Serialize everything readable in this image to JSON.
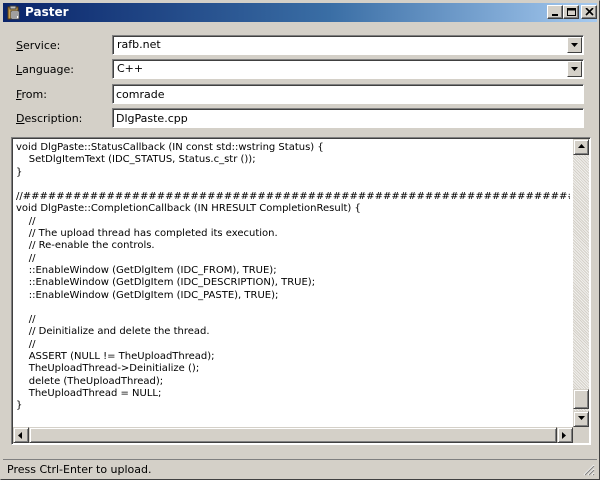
{
  "window": {
    "title": "Paster",
    "app_icon": "paste-app-icon",
    "controls": [
      "minimize-icon",
      "maximize-icon",
      "close-icon"
    ]
  },
  "form": {
    "service": {
      "label": "Service:",
      "accel": "S",
      "rest": "ervice:",
      "value": "rafb.net"
    },
    "language": {
      "label": "Language:",
      "accel": "L",
      "rest": "anguage:",
      "value": "C++"
    },
    "from": {
      "label": "From:",
      "accel": "F",
      "rest": "rom:",
      "value": "comrade"
    },
    "description": {
      "label": "Description:",
      "accel": "D",
      "rest": "escription:",
      "value": "DlgPaste.cpp"
    }
  },
  "editor": {
    "lines": [
      "void DlgPaste::StatusCallback (IN const std::wstring Status) {",
      "    SetDlgItemText (IDC_STATUS, Status.c_str ());",
      "}",
      "",
      "//##########################################################################",
      "void DlgPaste::CompletionCallback (IN HRESULT CompletionResult) {",
      "    //",
      "    // The upload thread has completed its execution.",
      "    // Re-enable the controls.",
      "    //",
      "    ::EnableWindow (GetDlgItem (IDC_FROM), TRUE);",
      "    ::EnableWindow (GetDlgItem (IDC_DESCRIPTION), TRUE);",
      "    ::EnableWindow (GetDlgItem (IDC_PASTE), TRUE);",
      "",
      "    //",
      "    // Deinitialize and delete the thread.",
      "    //",
      "    ASSERT (NULL != TheUploadThread);",
      "    TheUploadThread->Deinitialize ();",
      "    delete (TheUploadThread);",
      "    TheUploadThread = NULL;",
      "}",
      ""
    ]
  },
  "status": {
    "text": "Press Ctrl-Enter to upload."
  }
}
